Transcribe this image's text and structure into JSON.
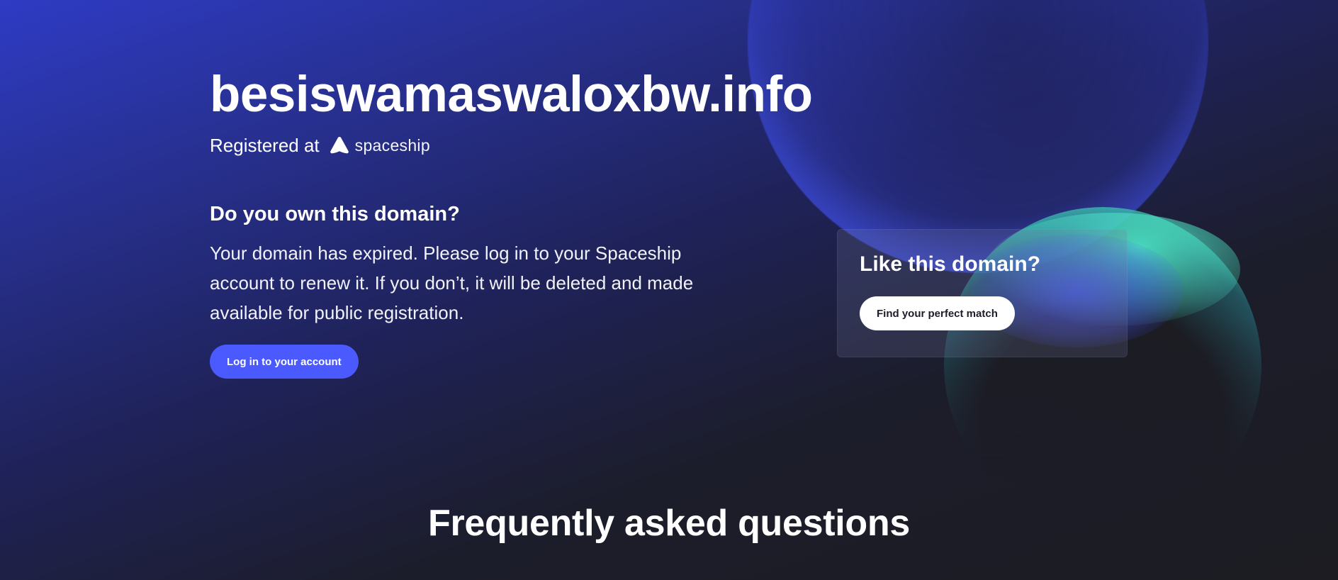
{
  "domain": {
    "name": "besiswamaswaloxbw.info"
  },
  "registrar": {
    "prefix": "Registered at",
    "brand_name": "spaceship",
    "logo_icon": "spaceship-logo-icon"
  },
  "ownership": {
    "heading": "Do you own this domain?",
    "body": "Your domain has expired. Please log in to your Spaceship account to renew it. If you don’t, it will be deleted and made available for public registration.",
    "login_button": "Log in to your account"
  },
  "promo": {
    "title": "Like this domain?",
    "button": "Find your perfect match"
  },
  "faq": {
    "heading": "Frequently asked questions"
  },
  "colors": {
    "accent": "#4a5aff",
    "background_dark": "#1c1c22",
    "background_blue": "#2e3bc4",
    "orb_green": "#46e8c8"
  }
}
